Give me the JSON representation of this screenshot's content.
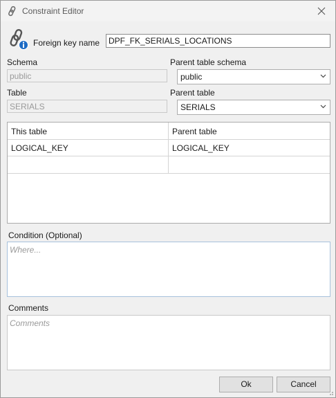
{
  "window": {
    "title": "Constraint Editor",
    "title_icon": "chain-link-icon",
    "close_icon": "close-icon"
  },
  "fk": {
    "label": "Foreign key name",
    "value": "DPF_FK_SERIALS_LOCATIONS",
    "icon": "foreign-key-info-icon"
  },
  "schema": {
    "label": "Schema",
    "value": "public"
  },
  "parent_schema": {
    "label": "Parent table schema",
    "value": "public"
  },
  "table": {
    "label": "Table",
    "value": "SERIALS"
  },
  "parent_table": {
    "label": "Parent table",
    "value": "SERIALS"
  },
  "grid": {
    "columns": [
      "This table",
      "Parent table"
    ],
    "rows": [
      [
        "LOGICAL_KEY",
        "LOGICAL_KEY"
      ],
      [
        "",
        ""
      ]
    ]
  },
  "condition": {
    "label": "Condition (Optional)",
    "placeholder": "Where..."
  },
  "comments": {
    "label": "Comments",
    "placeholder": "Comments"
  },
  "buttons": {
    "ok": "Ok",
    "cancel": "Cancel"
  },
  "colors": {
    "accent_border": "#a7c1dc",
    "background": "#f0f0f0"
  }
}
